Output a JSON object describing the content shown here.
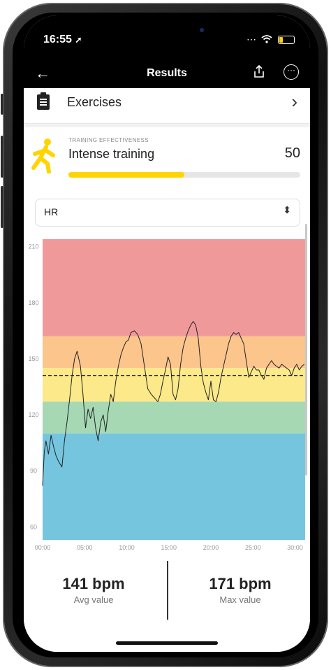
{
  "status": {
    "time": "16:55",
    "location_icon": "arrow-up-right-icon"
  },
  "nav": {
    "title": "Results",
    "back_icon": "back-arrow-icon",
    "share_icon": "share-icon",
    "more_icon": "more-icon"
  },
  "exercises": {
    "label": "Exercises",
    "icon": "clipboard-icon",
    "chevron": "chevron-right-icon"
  },
  "effectiveness": {
    "caption": "TRAINING EFFECTIVENESS",
    "title": "Intense training",
    "score": "50",
    "progress": 0.5,
    "bar_color": "#ffd400",
    "icon": "runner-icon"
  },
  "selector": {
    "value": "HR",
    "icon": "sort-icon"
  },
  "chart_data": {
    "type": "line",
    "y_ticks": [
      "210",
      "180",
      "150",
      "120",
      "90",
      "60"
    ],
    "x_ticks": [
      "00:00",
      "05:00",
      "10:00",
      "15:00",
      "20:00",
      "25:00",
      "30:00"
    ],
    "ylim": [
      53,
      214
    ],
    "xlim": [
      0,
      31.2
    ],
    "zones": [
      {
        "name": "red",
        "from": 162,
        "to": 214,
        "color": "#f0999a"
      },
      {
        "name": "orange",
        "from": 145,
        "to": 162,
        "color": "#fbc58c"
      },
      {
        "name": "yellow",
        "from": 127,
        "to": 145,
        "color": "#fbe98a"
      },
      {
        "name": "green",
        "from": 110,
        "to": 127,
        "color": "#a6d8b4"
      },
      {
        "name": "blue",
        "from": 53,
        "to": 110,
        "color": "#75c5df"
      }
    ],
    "average": 141,
    "series": [
      {
        "x": [
          0,
          0.2,
          0.4,
          0.7,
          1.0,
          1.3,
          1.6,
          1.9,
          2.3,
          2.6,
          2.9,
          3.2,
          3.5,
          3.8,
          4.1,
          4.5,
          4.8,
          5.1,
          5.4,
          5.7,
          6.0,
          6.3,
          6.6,
          6.9,
          7.2,
          7.5,
          7.8,
          8.1,
          8.4,
          8.7,
          9.0,
          9.3,
          9.6,
          9.9,
          10.2,
          10.5,
          10.9,
          11.3,
          11.7,
          12.1,
          12.5,
          12.9,
          13.3,
          13.7,
          14.0,
          14.3,
          14.6,
          14.9,
          15.2,
          15.5,
          15.8,
          16.1,
          16.4,
          16.7,
          17.0,
          17.3,
          17.6,
          17.9,
          18.2,
          18.5,
          18.8,
          19.1,
          19.4,
          19.7,
          20.0,
          20.3,
          20.6,
          20.9,
          21.2,
          21.5,
          21.8,
          22.1,
          22.4,
          22.7,
          23.0,
          23.3,
          23.6,
          23.9,
          24.2,
          24.5,
          24.8,
          25.1,
          25.4,
          25.7,
          26.0,
          26.3,
          26.6,
          26.9,
          27.2,
          27.5,
          27.8,
          28.1,
          28.4,
          28.7,
          29.0,
          29.3,
          29.6,
          29.9,
          30.2,
          30.5,
          30.8,
          31.1
        ],
        "y": [
          82,
          100,
          106,
          99,
          109,
          103,
          98,
          95,
          92,
          106,
          116,
          128,
          141,
          150,
          154,
          146,
          131,
          113,
          123,
          118,
          124,
          113,
          106,
          116,
          120,
          111,
          122,
          131,
          127,
          138,
          146,
          152,
          156,
          159,
          160,
          164,
          165,
          163,
          158,
          146,
          134,
          131,
          129,
          127,
          131,
          138,
          144,
          151,
          147,
          131,
          128,
          134,
          147,
          156,
          161,
          165,
          168,
          170,
          168,
          161,
          146,
          137,
          132,
          128,
          138,
          128,
          127,
          132,
          140,
          146,
          152,
          158,
          162,
          164,
          163,
          164,
          161,
          158,
          149,
          140,
          143,
          146,
          144,
          144,
          141,
          139,
          145,
          147,
          149,
          147,
          146,
          145,
          147,
          146,
          145,
          144,
          141,
          145,
          147,
          144,
          146,
          147
        ]
      }
    ]
  },
  "stats": {
    "avg_value": "141 bpm",
    "avg_label": "Avg value",
    "max_value": "171 bpm",
    "max_label": "Max value"
  }
}
